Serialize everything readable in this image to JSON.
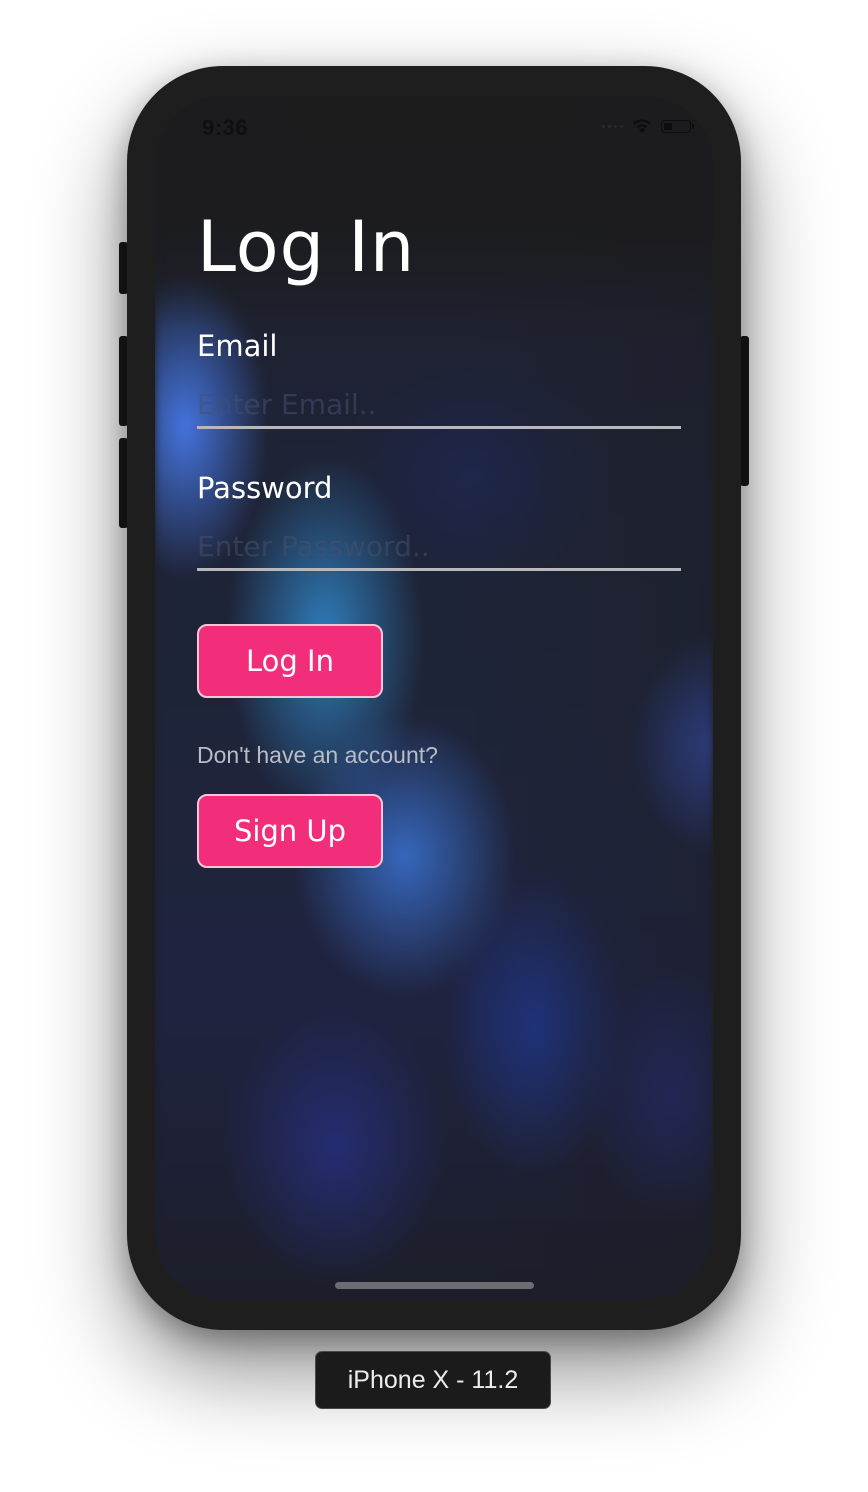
{
  "status_bar": {
    "time": "9:36",
    "icons": [
      "signal-dots-icon",
      "wifi-icon",
      "battery-icon"
    ]
  },
  "login_screen": {
    "title": "Log In",
    "email_label": "Email",
    "email_placeholder": "Enter Email..",
    "email_value": "",
    "password_label": "Password",
    "password_placeholder": "Enter Password..",
    "password_value": "",
    "login_button": "Log In",
    "signup_prompt": "Don't have an account?",
    "signup_button": "Sign Up"
  },
  "device": {
    "label": "iPhone X - 11.2"
  },
  "colors": {
    "accent_pink": "#f22e7a",
    "background_dark": "#1d1f2a",
    "device_frame": "#1e1e1e"
  }
}
